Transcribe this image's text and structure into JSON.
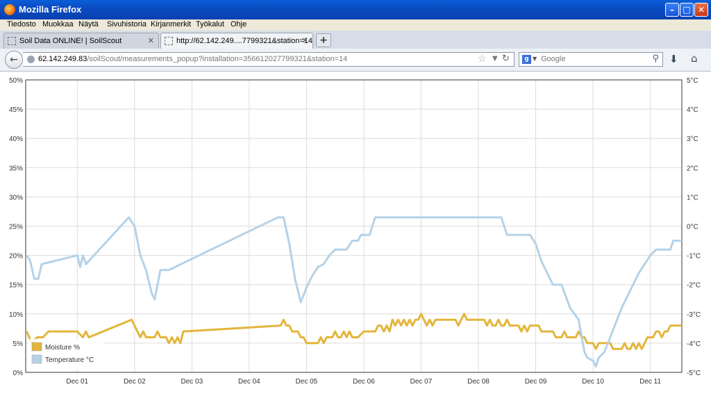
{
  "window": {
    "title": "Mozilla Firefox"
  },
  "menu": [
    "Tiedosto",
    "Muokkaa",
    "Näytä",
    "Sivuhistoria",
    "Kirjanmerkit",
    "Työkalut",
    "Ohje"
  ],
  "tabs": [
    {
      "label": "Soil Data ONLINE! | SoilScout",
      "active": false
    },
    {
      "label": "http://62.142.249....7799321&station=14",
      "active": true
    }
  ],
  "address": {
    "host": "62.142.249.83",
    "path": "/soilScout/measurements_popup?installation=356612027799321&station=14"
  },
  "search": {
    "engine": "Google",
    "placeholder": "Google"
  },
  "colors": {
    "moisture": "#e3b53a",
    "temperature": "#b4d2e8",
    "titlebar": "#0a4bc2"
  },
  "chart_data": {
    "type": "line",
    "x_tick_labels": [
      "Dec 01",
      "Dec 02",
      "Dec 03",
      "Dec 04",
      "Dec 05",
      "Dec 06",
      "Dec 07",
      "Dec 08",
      "Dec 09",
      "Dec 10",
      "Dec 11"
    ],
    "xlim": [
      0.1,
      11.55
    ],
    "y_left": {
      "ticks": [
        "0%",
        "5%",
        "10%",
        "15%",
        "20%",
        "25%",
        "30%",
        "35%",
        "40%",
        "45%",
        "50%"
      ],
      "range": [
        0,
        50
      ],
      "unit": "%"
    },
    "y_right": {
      "ticks": [
        "-5°C",
        "-4°C",
        "-3°C",
        "-2°C",
        "-1°C",
        "0°C",
        "1°C",
        "2°C",
        "3°C",
        "4°C",
        "5°C"
      ],
      "range": [
        -5,
        5
      ],
      "unit": "°C"
    },
    "grid": true,
    "legend_position": "bottom-left",
    "series": [
      {
        "name": "Moisture %",
        "axis": "left",
        "points": [
          [
            0.12,
            7
          ],
          [
            0.2,
            5
          ],
          [
            0.3,
            6
          ],
          [
            0.4,
            6
          ],
          [
            0.5,
            7
          ],
          [
            0.7,
            7
          ],
          [
            0.9,
            7
          ],
          [
            1.0,
            7
          ],
          [
            1.1,
            6
          ],
          [
            1.15,
            7
          ],
          [
            1.2,
            6
          ],
          [
            1.95,
            9
          ],
          [
            2.05,
            7
          ],
          [
            2.1,
            6
          ],
          [
            2.15,
            7
          ],
          [
            2.2,
            6
          ],
          [
            2.35,
            6
          ],
          [
            2.4,
            7
          ],
          [
            2.45,
            6
          ],
          [
            2.55,
            6
          ],
          [
            2.6,
            5
          ],
          [
            2.65,
            6
          ],
          [
            2.7,
            5
          ],
          [
            2.75,
            6
          ],
          [
            2.8,
            5
          ],
          [
            2.85,
            7
          ],
          [
            4.55,
            8
          ],
          [
            4.6,
            9
          ],
          [
            4.65,
            8
          ],
          [
            4.7,
            8
          ],
          [
            4.75,
            7
          ],
          [
            4.85,
            7
          ],
          [
            4.9,
            6
          ],
          [
            4.95,
            6
          ],
          [
            5.0,
            5
          ],
          [
            5.2,
            5
          ],
          [
            5.25,
            6
          ],
          [
            5.3,
            5
          ],
          [
            5.35,
            6
          ],
          [
            5.45,
            6
          ],
          [
            5.5,
            7
          ],
          [
            5.55,
            6
          ],
          [
            5.6,
            6
          ],
          [
            5.65,
            7
          ],
          [
            5.7,
            6
          ],
          [
            5.75,
            7
          ],
          [
            5.8,
            6
          ],
          [
            5.9,
            6
          ],
          [
            6.0,
            7
          ],
          [
            6.2,
            7
          ],
          [
            6.25,
            8
          ],
          [
            6.3,
            8
          ],
          [
            6.35,
            7
          ],
          [
            6.4,
            8
          ],
          [
            6.45,
            7
          ],
          [
            6.5,
            9
          ],
          [
            6.55,
            8
          ],
          [
            6.6,
            9
          ],
          [
            6.65,
            8
          ],
          [
            6.7,
            9
          ],
          [
            6.75,
            8
          ],
          [
            6.8,
            9
          ],
          [
            6.85,
            8
          ],
          [
            6.9,
            9
          ],
          [
            6.95,
            9
          ],
          [
            7.0,
            10
          ],
          [
            7.05,
            9
          ],
          [
            7.1,
            8
          ],
          [
            7.15,
            9
          ],
          [
            7.2,
            8
          ],
          [
            7.25,
            9
          ],
          [
            7.6,
            9
          ],
          [
            7.65,
            8
          ],
          [
            7.7,
            9
          ],
          [
            7.75,
            10
          ],
          [
            7.8,
            9
          ],
          [
            8.1,
            9
          ],
          [
            8.15,
            8
          ],
          [
            8.2,
            9
          ],
          [
            8.25,
            8
          ],
          [
            8.3,
            8
          ],
          [
            8.35,
            9
          ],
          [
            8.4,
            8
          ],
          [
            8.45,
            8
          ],
          [
            8.5,
            9
          ],
          [
            8.55,
            8
          ],
          [
            8.7,
            8
          ],
          [
            8.75,
            7
          ],
          [
            8.8,
            8
          ],
          [
            8.85,
            7
          ],
          [
            8.9,
            8
          ],
          [
            8.95,
            8
          ],
          [
            9.05,
            8
          ],
          [
            9.1,
            7
          ],
          [
            9.3,
            7
          ],
          [
            9.35,
            6
          ],
          [
            9.45,
            6
          ],
          [
            9.5,
            7
          ],
          [
            9.55,
            6
          ],
          [
            9.6,
            6
          ],
          [
            9.7,
            6
          ],
          [
            9.75,
            7
          ],
          [
            9.8,
            6
          ],
          [
            9.85,
            6
          ],
          [
            9.9,
            5
          ],
          [
            10.0,
            5
          ],
          [
            10.05,
            4
          ],
          [
            10.1,
            5
          ],
          [
            10.15,
            5
          ],
          [
            10.3,
            5
          ],
          [
            10.35,
            4
          ],
          [
            10.5,
            4
          ],
          [
            10.55,
            5
          ],
          [
            10.6,
            4
          ],
          [
            10.65,
            4
          ],
          [
            10.7,
            5
          ],
          [
            10.75,
            4
          ],
          [
            10.8,
            5
          ],
          [
            10.85,
            4
          ],
          [
            10.9,
            5
          ],
          [
            10.95,
            6
          ],
          [
            11.05,
            6
          ],
          [
            11.1,
            7
          ],
          [
            11.15,
            7
          ],
          [
            11.2,
            6
          ],
          [
            11.25,
            7
          ],
          [
            11.3,
            7
          ],
          [
            11.35,
            8
          ],
          [
            11.55,
            8
          ]
        ]
      },
      {
        "name": "Temperature °C",
        "axis": "right",
        "points": [
          [
            0.12,
            -1
          ],
          [
            0.18,
            -1.2
          ],
          [
            0.25,
            -1.8
          ],
          [
            0.32,
            -1.8
          ],
          [
            0.38,
            -1.3
          ],
          [
            1.0,
            -1
          ],
          [
            1.05,
            -1.4
          ],
          [
            1.1,
            -1
          ],
          [
            1.15,
            -1.3
          ],
          [
            1.9,
            0.3
          ],
          [
            2.0,
            0
          ],
          [
            2.1,
            -1
          ],
          [
            2.2,
            -1.5
          ],
          [
            2.3,
            -2.3
          ],
          [
            2.35,
            -2.5
          ],
          [
            2.45,
            -1.5
          ],
          [
            2.6,
            -1.5
          ],
          [
            4.5,
            0.3
          ],
          [
            4.6,
            0.3
          ],
          [
            4.7,
            -0.6
          ],
          [
            4.8,
            -1.8
          ],
          [
            4.9,
            -2.6
          ],
          [
            5.0,
            -2.1
          ],
          [
            5.1,
            -1.7
          ],
          [
            5.2,
            -1.4
          ],
          [
            5.3,
            -1.3
          ],
          [
            5.4,
            -1
          ],
          [
            5.5,
            -0.8
          ],
          [
            5.7,
            -0.8
          ],
          [
            5.8,
            -0.5
          ],
          [
            5.9,
            -0.5
          ],
          [
            5.95,
            -0.3
          ],
          [
            6.1,
            -0.3
          ],
          [
            6.2,
            0.3
          ],
          [
            8.4,
            0.3
          ],
          [
            8.5,
            -0.3
          ],
          [
            8.9,
            -0.3
          ],
          [
            9.0,
            -0.6
          ],
          [
            9.1,
            -1.2
          ],
          [
            9.2,
            -1.6
          ],
          [
            9.3,
            -2
          ],
          [
            9.45,
            -2
          ],
          [
            9.6,
            -2.8
          ],
          [
            9.75,
            -3.2
          ],
          [
            9.85,
            -4.3
          ],
          [
            9.9,
            -4.5
          ],
          [
            10.0,
            -4.6
          ],
          [
            10.05,
            -4.8
          ],
          [
            10.1,
            -4.5
          ],
          [
            10.2,
            -4.3
          ],
          [
            10.3,
            -3.8
          ],
          [
            10.4,
            -3.3
          ],
          [
            10.5,
            -2.8
          ],
          [
            10.6,
            -2.4
          ],
          [
            10.7,
            -2
          ],
          [
            10.8,
            -1.6
          ],
          [
            10.9,
            -1.3
          ],
          [
            11.0,
            -1
          ],
          [
            11.1,
            -0.8
          ],
          [
            11.35,
            -0.8
          ],
          [
            11.4,
            -0.5
          ],
          [
            11.55,
            -0.5
          ]
        ]
      }
    ]
  }
}
